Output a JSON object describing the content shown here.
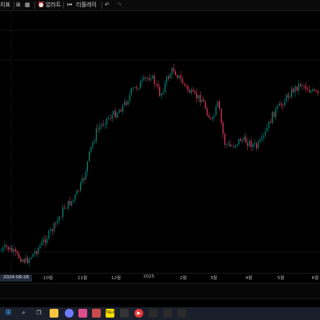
{
  "toolbar": {
    "indicators_label": "지표",
    "alert_label": "얼러트",
    "replay_label": "리플레이"
  },
  "chart_data": {
    "type": "candlestick",
    "x_ticks": [
      "10월",
      "11월",
      "12월",
      "2025",
      "2월",
      "3월",
      "4월",
      "5월",
      "6월"
    ],
    "cursor_date": "2024-08-28",
    "series_path": [
      [
        0,
        300
      ],
      [
        0.02,
        295
      ],
      [
        0.05,
        305
      ],
      [
        0.08,
        313
      ],
      [
        0.11,
        300
      ],
      [
        0.14,
        285
      ],
      [
        0.17,
        268
      ],
      [
        0.2,
        245
      ],
      [
        0.23,
        235
      ],
      [
        0.26,
        210
      ],
      [
        0.28,
        175
      ],
      [
        0.3,
        150
      ],
      [
        0.33,
        135
      ],
      [
        0.36,
        128
      ],
      [
        0.39,
        115
      ],
      [
        0.41,
        100
      ],
      [
        0.44,
        90
      ],
      [
        0.47,
        80
      ],
      [
        0.5,
        105
      ],
      [
        0.52,
        85
      ],
      [
        0.54,
        72
      ],
      [
        0.57,
        90
      ],
      [
        0.6,
        105
      ],
      [
        0.63,
        110
      ],
      [
        0.66,
        140
      ],
      [
        0.68,
        115
      ],
      [
        0.7,
        165
      ],
      [
        0.72,
        170
      ],
      [
        0.75,
        160
      ],
      [
        0.78,
        165
      ],
      [
        0.8,
        170
      ],
      [
        0.82,
        160
      ],
      [
        0.85,
        130
      ],
      [
        0.88,
        115
      ],
      [
        0.91,
        100
      ],
      [
        0.94,
        90
      ],
      [
        0.97,
        100
      ],
      [
        1.0,
        105
      ]
    ]
  },
  "colors": {
    "up": "#00897b",
    "down": "#e5395d"
  },
  "taskbar_icons": [
    "windows-icon",
    "search-icon",
    "task-view-icon",
    "file-explorer-icon",
    "chrome-icon",
    "app-icon",
    "app-icon",
    "kakaotalk-icon",
    "app-icon",
    "youtube-icon",
    "app-icon",
    "app-icon",
    "app-icon"
  ]
}
